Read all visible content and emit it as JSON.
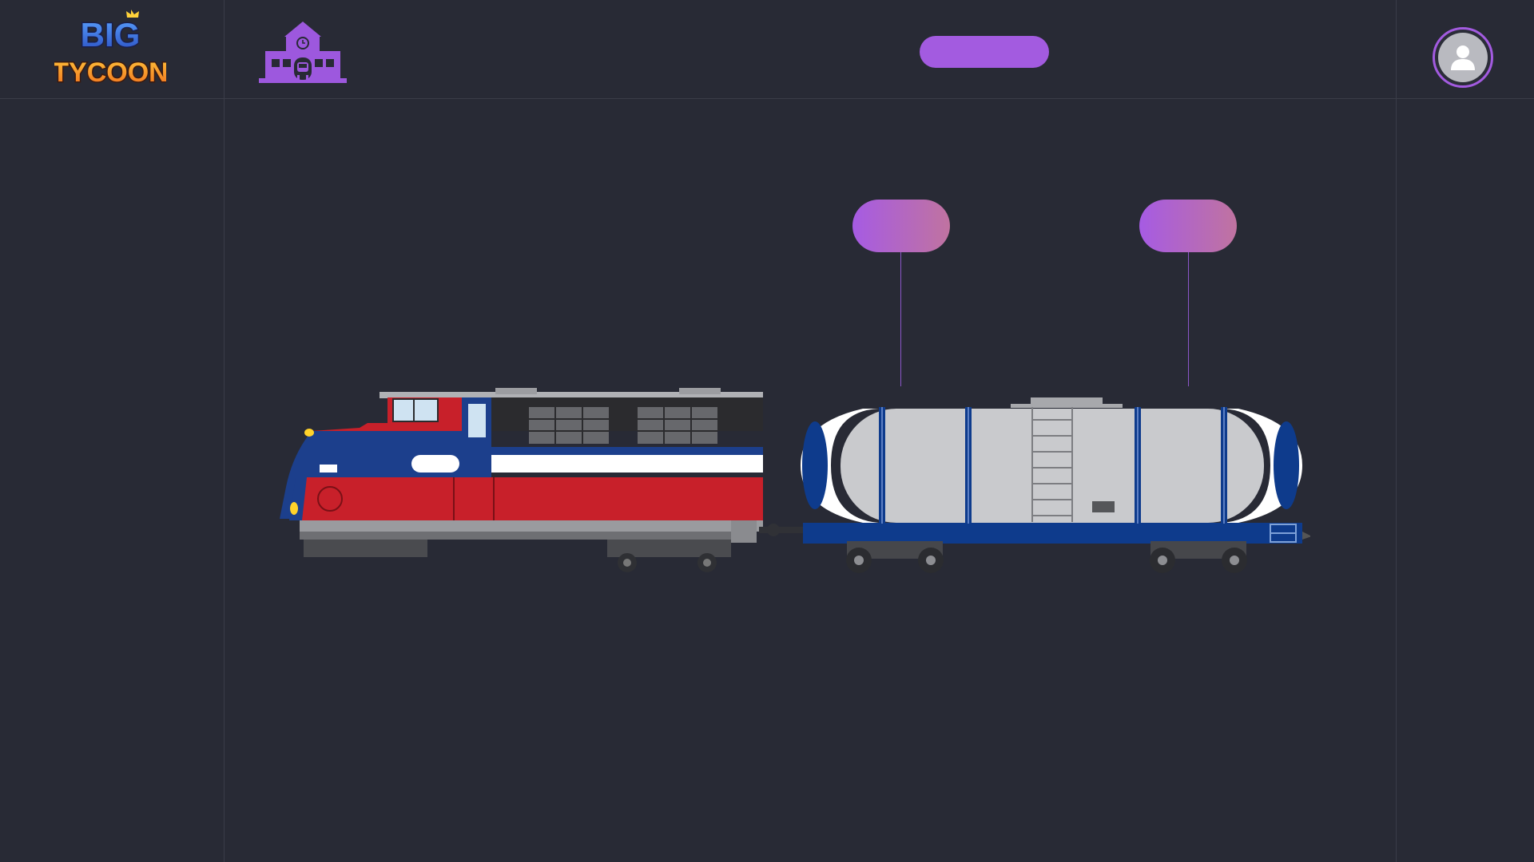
{
  "app": {
    "logo_line1": "BIG",
    "logo_line2": "TYCOON",
    "logo_icon": "big-tycoon-logo",
    "station_icon": "train-station-icon",
    "avatar_icon": "user-icon"
  },
  "header": {
    "center_pill_label": ""
  },
  "train": {
    "locomotive": {
      "name": "",
      "colors": {
        "body_red": "#c8202a",
        "body_blue": "#1c3f8c",
        "roof": "#2b2b2e",
        "stripe": "#ffffff"
      }
    },
    "cars": [
      {
        "type": "tank-car",
        "tag_label": "",
        "colors": {
          "tank": "#c9cacd",
          "frame": "#0e3b8c",
          "caps": "#0e3b8c"
        }
      }
    ],
    "car_tags": [
      {
        "label": ""
      },
      {
        "label": ""
      }
    ]
  },
  "theme": {
    "background": "#282a35",
    "accent": "#a35be0",
    "gridline": "#3a3c48"
  }
}
